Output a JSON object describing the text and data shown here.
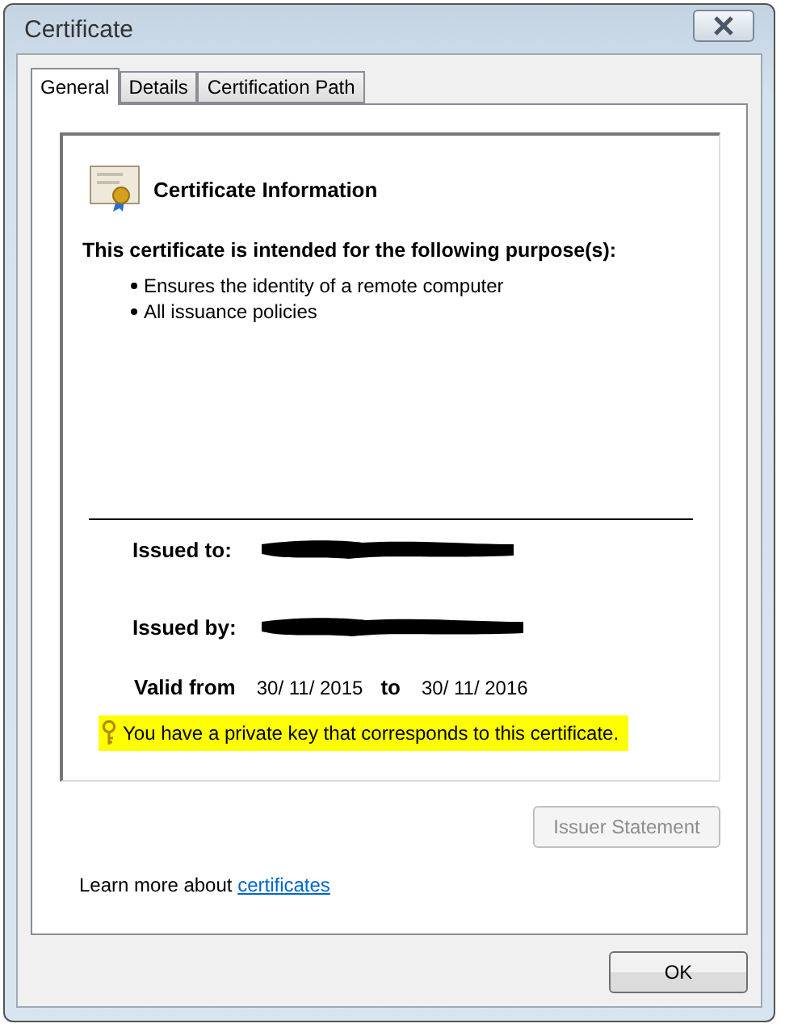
{
  "window": {
    "title": "Certificate"
  },
  "tabs": [
    {
      "label": "General",
      "selected": true
    },
    {
      "label": "Details",
      "selected": false
    },
    {
      "label": "Certification Path",
      "selected": false
    }
  ],
  "certificate": {
    "heading": "Certificate Information",
    "purpose_heading": "This certificate is intended for the following purpose(s):",
    "purposes": [
      "Ensures the identity of a remote computer",
      "All issuance policies"
    ],
    "issued_to": {
      "label": "Issued to:",
      "redacted": true
    },
    "issued_by": {
      "label": "Issued by:",
      "redacted": true
    },
    "validity": {
      "from_label": "Valid from",
      "from": "30/ 11/ 2015",
      "to_label": "to",
      "to": "30/ 11/ 2016"
    },
    "private_key_note": {
      "text": "You have a private key that corresponds to this certificate.",
      "highlighted": true
    }
  },
  "issuer_statement": {
    "label": "Issuer Statement",
    "disabled": true
  },
  "learn_more": {
    "text": "Learn more about",
    "link": "certificates"
  },
  "buttons": [
    "OK"
  ]
}
